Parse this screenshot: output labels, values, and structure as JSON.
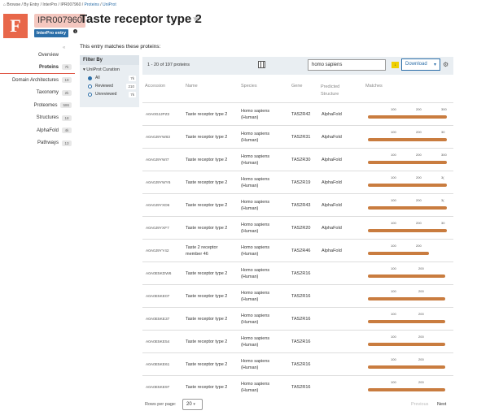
{
  "breadcrumb": {
    "home_icon": "home-icon",
    "items": [
      "Browse",
      "By Entry",
      "InterPro",
      "IPR007960",
      "Proteins",
      "UniProt"
    ],
    "sep": " / "
  },
  "entry": {
    "logo_letter": "F",
    "accession": "IPR007960",
    "title": "Taste receptor type 2",
    "type_badge": "InterPro entry"
  },
  "sidebar": {
    "items": [
      {
        "label": "Overview",
        "count": ""
      },
      {
        "label": "Proteins",
        "count": "7k"
      },
      {
        "label": "Domain Architectures",
        "count": "19"
      },
      {
        "label": "Taxonomy",
        "count": "2k"
      },
      {
        "label": "Proteomes",
        "count": "586"
      },
      {
        "label": "Structures",
        "count": "18"
      },
      {
        "label": "AlphaFold",
        "count": "4k"
      },
      {
        "label": "Pathways",
        "count": "13"
      }
    ]
  },
  "main": {
    "intro": "This entry matches these proteins:"
  },
  "filter": {
    "title": "Filter By",
    "group": "UniProt Curation",
    "options": [
      {
        "label": "All",
        "count": "7k",
        "selected": true
      },
      {
        "label": "Reviewed",
        "count": "210",
        "selected": false
      },
      {
        "label": "Unreviewed",
        "count": "7k",
        "selected": false
      }
    ]
  },
  "toolbar": {
    "count_text": "1 - 20 of 197 proteins",
    "search_value": "homo sapiens",
    "download_label": "Download",
    "download_caret": "▾"
  },
  "table": {
    "headers": [
      "Accession",
      "Name",
      "Species",
      "Gene",
      "Predicted Structure",
      "Matches"
    ],
    "rows": [
      {
        "acc": "A0A0G2JPZ2",
        "name": "Taste receptor type 2",
        "species": "Homo sapiens (Human)",
        "gene": "TAS2R42",
        "af": "AlphaFold",
        "ticks": [
          "100",
          "200",
          "300"
        ]
      },
      {
        "acc": "A0A0J9YW83",
        "name": "Taste receptor type 2",
        "species": "Homo sapiens (Human)",
        "gene": "TAS2R31",
        "af": "AlphaFold",
        "ticks": [
          "100",
          "200",
          "30"
        ]
      },
      {
        "acc": "A0A0J9YWI7",
        "name": "Taste receptor type 2",
        "species": "Homo sapiens (Human)",
        "gene": "TAS2R30",
        "af": "AlphaFold",
        "ticks": [
          "100",
          "200",
          "300"
        ]
      },
      {
        "acc": "A0A0J9YWY6",
        "name": "Taste receptor type 2",
        "species": "Homo sapiens (Human)",
        "gene": "TAS2R19",
        "af": "AlphaFold",
        "ticks": [
          "100",
          "200",
          "3("
        ]
      },
      {
        "acc": "A0A0J9YXD6",
        "name": "Taste receptor type 2",
        "species": "Homo sapiens (Human)",
        "gene": "TAS2R43",
        "af": "AlphaFold",
        "ticks": [
          "100",
          "200",
          "3("
        ]
      },
      {
        "acc": "A0A0J9YXF7",
        "name": "Taste receptor type 2",
        "species": "Homo sapiens (Human)",
        "gene": "TAS2R20",
        "af": "AlphaFold",
        "ticks": [
          "100",
          "200",
          "30"
        ]
      },
      {
        "acc": "A0A0J9YY42",
        "name": "Taste 2 receptor member 46",
        "species": "Homo sapiens (Human)",
        "gene": "TAS2R46",
        "af": "AlphaFold",
        "ticks": [
          "100",
          "200",
          ""
        ]
      },
      {
        "acc": "A0A0E5KDW6",
        "name": "Taste receptor type 2",
        "species": "Homo sapiens (Human)",
        "gene": "TAS2R16",
        "af": "",
        "ticks": [
          "100",
          "200",
          ""
        ]
      },
      {
        "acc": "A0A0E5KE07",
        "name": "Taste receptor type 2",
        "species": "Homo sapiens (Human)",
        "gene": "TAS2R16",
        "af": "",
        "ticks": [
          "100",
          "200",
          ""
        ]
      },
      {
        "acc": "A0A0E5KE37",
        "name": "Taste receptor type 2",
        "species": "Homo sapiens (Human)",
        "gene": "TAS2R16",
        "af": "",
        "ticks": [
          "100",
          "200",
          ""
        ]
      },
      {
        "acc": "A0A0E5KE54",
        "name": "Taste receptor type 2",
        "species": "Homo sapiens (Human)",
        "gene": "TAS2R16",
        "af": "",
        "ticks": [
          "100",
          "200",
          ""
        ]
      },
      {
        "acc": "A0A0E5KE61",
        "name": "Taste receptor type 2",
        "species": "Homo sapiens (Human)",
        "gene": "TAS2R16",
        "af": "",
        "ticks": [
          "100",
          "200",
          ""
        ]
      },
      {
        "acc": "A0A0E5KE97",
        "name": "Taste receptor type 2",
        "species": "Homo sapiens (Human)",
        "gene": "TAS2R16",
        "af": "",
        "ticks": [
          "100",
          "200",
          ""
        ]
      }
    ]
  },
  "footer": {
    "rows_label": "Rows per page:",
    "rows_value": "20",
    "prev": "Previous",
    "next": "Next"
  },
  "colors": {
    "accent": "#2b6ea8",
    "logo": "#e8674a",
    "match_bar": "#c97c3f",
    "active_tab": "#e05a4a"
  }
}
